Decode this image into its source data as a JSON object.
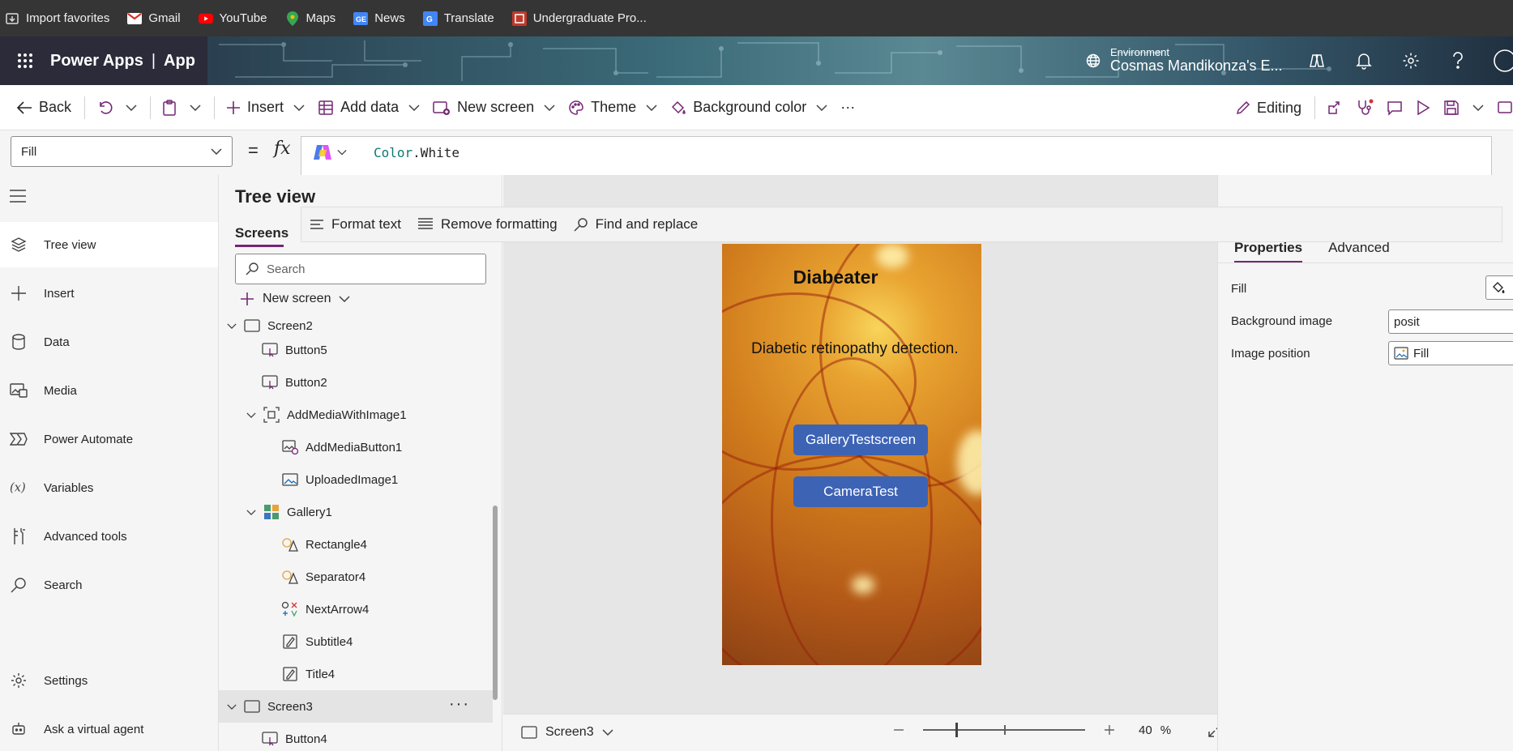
{
  "bookmarks": [
    {
      "label": "Import favorites",
      "icon": "import-icon"
    },
    {
      "label": "Gmail",
      "icon": "gmail-icon"
    },
    {
      "label": "YouTube",
      "icon": "youtube-icon"
    },
    {
      "label": "Maps",
      "icon": "maps-icon"
    },
    {
      "label": "News",
      "icon": "news-icon"
    },
    {
      "label": "Translate",
      "icon": "translate-icon"
    },
    {
      "label": "Undergraduate Pro...",
      "icon": "bookmark-icon"
    }
  ],
  "header": {
    "product": "Power Apps",
    "separator": "|",
    "app": "App",
    "env_label": "Environment",
    "env_name": "Cosmas Mandikonza's E..."
  },
  "commandbar": {
    "back": "Back",
    "insert": "Insert",
    "add_data": "Add data",
    "new_screen": "New screen",
    "theme": "Theme",
    "background_color": "Background color",
    "more": "···",
    "editing": "Editing"
  },
  "formula": {
    "property": "Fill",
    "equals": "=",
    "fx": "fx",
    "keyword": "Color",
    "rest": ".White",
    "format_text": "Format text",
    "remove_formatting": "Remove formatting",
    "find_replace": "Find and replace"
  },
  "leftnav": [
    {
      "label": "Tree view",
      "icon": "layers-icon",
      "active": true
    },
    {
      "label": "Insert",
      "icon": "plus-icon"
    },
    {
      "label": "Data",
      "icon": "database-icon"
    },
    {
      "label": "Media",
      "icon": "media-icon"
    },
    {
      "label": "Power Automate",
      "icon": "power-automate-icon"
    },
    {
      "label": "Variables",
      "icon": "variables-icon"
    },
    {
      "label": "Advanced tools",
      "icon": "tools-icon"
    },
    {
      "label": "Search",
      "icon": "search-icon"
    },
    {
      "label": "Settings",
      "icon": "gear-icon"
    },
    {
      "label": "Ask a virtual agent",
      "icon": "agent-icon"
    }
  ],
  "tree": {
    "title": "Tree view",
    "tab": "Screens",
    "search_placeholder": "Search",
    "new_screen": "New screen",
    "items": [
      {
        "label": "Screen2",
        "icon": "screen-icon",
        "depth": 0,
        "expanded": true
      },
      {
        "label": "Button5",
        "icon": "button-icon",
        "depth": 1
      },
      {
        "label": "Button2",
        "icon": "button-icon",
        "depth": 1
      },
      {
        "label": "AddMediaWithImage1",
        "icon": "group-icon",
        "depth": 1,
        "expanded": true
      },
      {
        "label": "AddMediaButton1",
        "icon": "add-media-icon",
        "depth": 2
      },
      {
        "label": "UploadedImage1",
        "icon": "image-icon",
        "depth": 2
      },
      {
        "label": "Gallery1",
        "icon": "gallery-icon",
        "depth": 1,
        "expanded": true
      },
      {
        "label": "Rectangle4",
        "icon": "shape-icon",
        "depth": 2
      },
      {
        "label": "Separator4",
        "icon": "shape-icon",
        "depth": 2
      },
      {
        "label": "NextArrow4",
        "icon": "icon-control-icon",
        "depth": 2
      },
      {
        "label": "Subtitle4",
        "icon": "label-icon",
        "depth": 2
      },
      {
        "label": "Title4",
        "icon": "label-icon",
        "depth": 2
      },
      {
        "label": "Screen3",
        "icon": "screen-icon",
        "depth": 0,
        "expanded": true,
        "selected": true
      },
      {
        "label": "Button4",
        "icon": "button-icon",
        "depth": 1
      }
    ]
  },
  "canvas": {
    "app_title": "Diabeater",
    "app_subtitle": "Diabetic retinopathy detection.",
    "buttons": [
      "GalleryTestscreen",
      "CameraTest"
    ],
    "screen_name": "Screen3",
    "zoom_value": "40",
    "zoom_unit": "%",
    "zoom_level": 0.4,
    "button_color": "#3d63b5"
  },
  "properties": {
    "tabs": [
      "Properties",
      "Advanced"
    ],
    "rows": [
      {
        "label": "Fill",
        "value": ""
      },
      {
        "label": "Background image",
        "value": "posit"
      },
      {
        "label": "Image position",
        "value": "Fill"
      }
    ]
  },
  "colors": {
    "accent": "#742774",
    "header_bg": "#2b2b3a",
    "bookmarks_bg": "#353535"
  }
}
